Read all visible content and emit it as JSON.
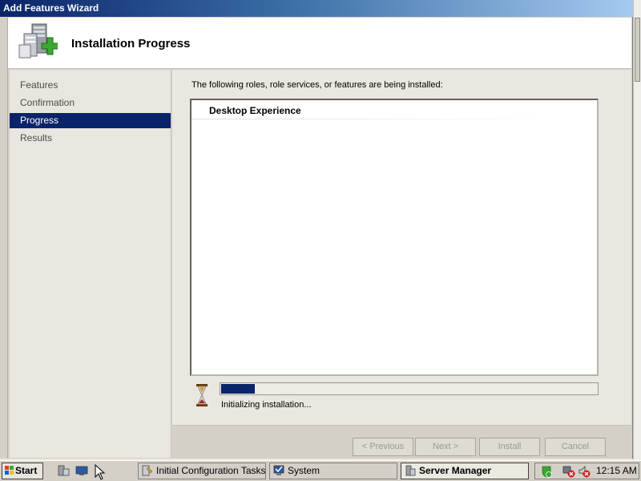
{
  "window": {
    "title": "Add Features Wizard"
  },
  "header": {
    "title": "Installation Progress",
    "icon": "server-add-icon"
  },
  "nav": {
    "items": [
      {
        "label": "Features",
        "active": false
      },
      {
        "label": "Confirmation",
        "active": false
      },
      {
        "label": "Progress",
        "active": true
      },
      {
        "label": "Results",
        "active": false
      }
    ]
  },
  "content": {
    "description": "The following roles, role services, or features are being installed:",
    "list": [
      "Desktop Experience"
    ],
    "progress_fraction": 0.09,
    "status": "Initializing installation..."
  },
  "buttons": {
    "previous": "< Previous",
    "next": "Next >",
    "install": "Install",
    "cancel": "Cancel"
  },
  "taskbar": {
    "start": "Start",
    "tasks": [
      {
        "label": "Initial Configuration Tasks",
        "active": false
      },
      {
        "label": "System",
        "active": false
      },
      {
        "label": "Server Manager",
        "active": true
      }
    ],
    "clock": "12:15 AM"
  },
  "colors": {
    "selection": "#0a246a",
    "accent_green": "#3aa832"
  }
}
